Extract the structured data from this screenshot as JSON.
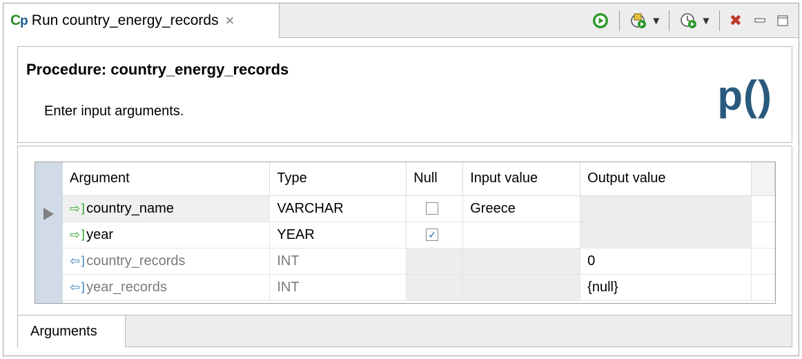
{
  "tab": {
    "icon_text_c": "C",
    "icon_text_p": "p",
    "title": "Run country_energy_records",
    "close_glyph": "×"
  },
  "toolbar": {
    "run_icon": "run-icon",
    "execute_icon": "execute-icon",
    "history_icon": "history-icon",
    "stop_glyph": "✖",
    "minimize_glyph": "▭",
    "maximize_glyph": "☐"
  },
  "header": {
    "title": "Procedure: country_energy_records",
    "subtitle": "Enter input arguments.",
    "logo": "p()"
  },
  "table": {
    "columns": [
      "Argument",
      "Type",
      "Null",
      "Input value",
      "Output value"
    ],
    "rows": [
      {
        "direction": "in",
        "arrow": "⇨]",
        "name": "country_name",
        "type": "VARCHAR",
        "null_checked": false,
        "input": "Greece",
        "output": ""
      },
      {
        "direction": "in",
        "arrow": "⇨]",
        "name": "year",
        "type": "YEAR",
        "null_checked": true,
        "input": "",
        "output": ""
      },
      {
        "direction": "out",
        "arrow": "⇦]",
        "name": "country_records",
        "type": "INT",
        "null_checked": null,
        "input": "",
        "output": "0"
      },
      {
        "direction": "out",
        "arrow": "⇦]",
        "name": "year_records",
        "type": "INT",
        "null_checked": null,
        "input": "",
        "output": "{null}"
      }
    ]
  },
  "bottom_tabs": [
    "Arguments"
  ],
  "colors": {
    "in_arrow": "#3aa83a",
    "out_arrow": "#4a88c0",
    "logo": "#2a5a7e",
    "stop": "#c0392b",
    "run": "#2e9a2e"
  }
}
